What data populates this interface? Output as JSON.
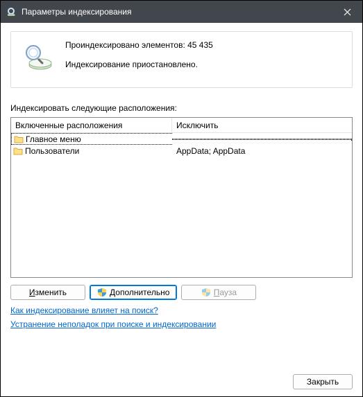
{
  "window": {
    "title": "Параметры индексирования"
  },
  "info": {
    "indexed": "Проиндексировано элементов: 45 435",
    "status": "Индексирование приостановлено."
  },
  "section_label": "Индексировать следующие расположения:",
  "columns": {
    "included": "Включенные расположения",
    "excluded": "Исключить"
  },
  "rows": [
    {
      "name": "Главное меню",
      "exclude": ""
    },
    {
      "name": "Пользователи",
      "exclude": "AppData; AppData"
    }
  ],
  "buttons": {
    "modify_pre": "И",
    "modify_rest": "зменить",
    "advanced_pre": "Д",
    "advanced_rest": "ополнительно",
    "pause_pre": "П",
    "pause_rest": "ауза",
    "close": "Закрыть"
  },
  "links": {
    "how": "Как индексирование влияет на поиск?",
    "troubleshoot": "Устранение неполадок при поиске и индексировании"
  }
}
